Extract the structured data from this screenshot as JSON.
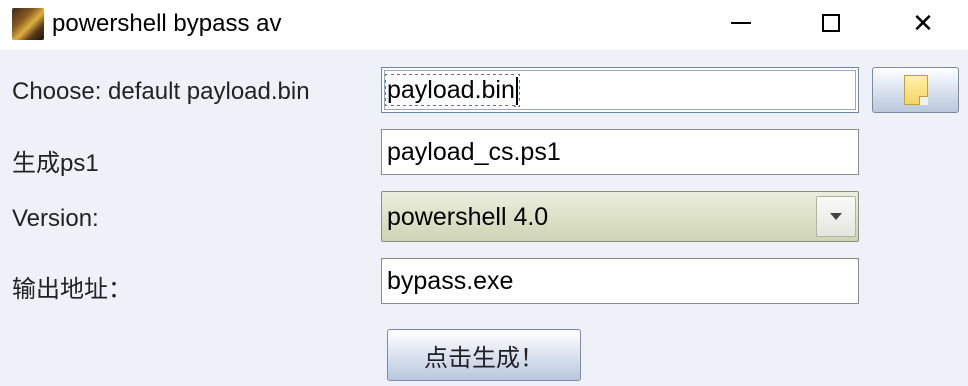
{
  "window": {
    "title": "powershell bypass av",
    "controls": {
      "minimize": "minimize",
      "maximize": "maximize",
      "close": "✕"
    }
  },
  "form": {
    "choose_label": "Choose: default payload.bin",
    "choose_value": "payload.bin",
    "generate_ps1_label": "生成ps1",
    "generate_ps1_value": "payload_cs.ps1",
    "version_label": "Version:",
    "version_selected": "powershell 4.0",
    "output_label": "输出地址：",
    "output_value": "bypass.exe",
    "generate_button": "点击生成！"
  },
  "icons": {
    "app": "app-icon",
    "browse": "folder-icon",
    "dropdown": "chevron-down-icon"
  }
}
